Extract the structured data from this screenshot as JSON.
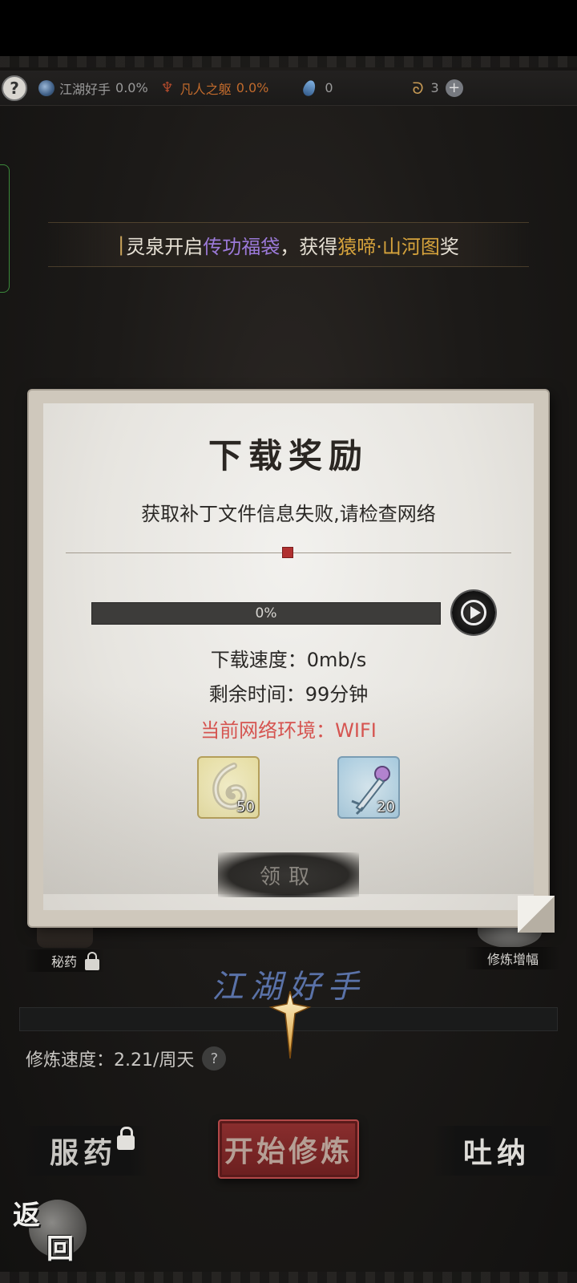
{
  "topbar": {
    "help": "?",
    "rank": {
      "label": "江湖好手",
      "value": "0.0%"
    },
    "body": {
      "label": "凡人之躯",
      "value": "0.0%"
    },
    "drops": {
      "value": "0"
    },
    "coils": {
      "value": "3"
    },
    "plus": "+"
  },
  "announcement": {
    "bar": "|",
    "part1": "灵泉开启",
    "part2": "传功福袋",
    "part3": "，获得",
    "part4": "猿啼·山河图",
    "part5": "奖"
  },
  "dialog": {
    "title": "下载奖励",
    "message": "获取补丁文件信息失败,请检查网络",
    "progress_text": "0%",
    "progress": 0,
    "speed": "下载速度：0mb/s",
    "remaining": "剩余时间：99分钟",
    "network": "当前网络环境：WIFI",
    "rewards": [
      {
        "icon": "jade-pendant-icon",
        "count": "50"
      },
      {
        "icon": "ornate-key-icon",
        "count": "20"
      }
    ],
    "claim_label": "领取"
  },
  "game": {
    "secret_medicine": "秘药",
    "cultivation_boost": "修炼增幅",
    "rank_name": "江湖好手",
    "speed": "修炼速度：2.21/周天",
    "help": "?"
  },
  "actions": {
    "take_medicine": "服药",
    "start_cultivation": "开始修炼",
    "breathe": "吐纳",
    "back_1": "返",
    "back_2": "回"
  },
  "colors": {
    "announce_purple": "#9b79d8",
    "announce_gold": "#d6a33c",
    "network_red": "#d9534f",
    "start_button_red": "#8a2e2e"
  }
}
